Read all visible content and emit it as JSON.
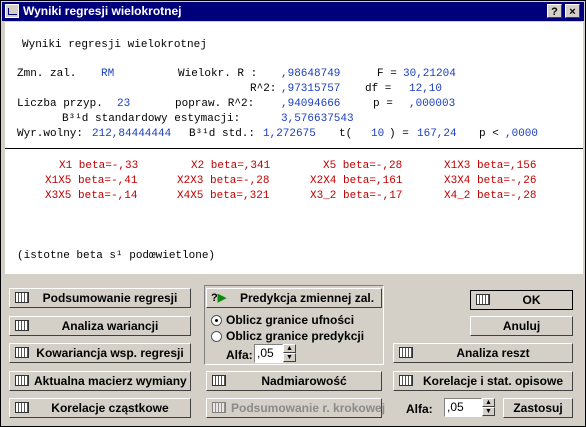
{
  "window": {
    "title": "Wyniki regresji wielokrotnej",
    "help_label": "?",
    "close_label": "×"
  },
  "output": {
    "heading": "Wyniki regresji wielokrotnej",
    "stats": {
      "zmn_label": "Zmn. zal.",
      "zmn_value": "RM",
      "r_label": "Wielokr. R :",
      "r_value": ",98648749",
      "f_label": "F =",
      "f_value": "30,21204",
      "r2_label": "R^2:",
      "r2_value": ",97315757",
      "df_label": "df =",
      "df_value": "12,10",
      "n_label": "Liczba przyp.",
      "n_value": "23",
      "adj_label": "popraw. R^2:",
      "adj_value": ",94094666",
      "p_label": "p =",
      "p_value": ",000003",
      "se_label": "B³¹d standardowy estymacji:",
      "se_value": "3,576637543",
      "int_label": "Wyr.wolny:",
      "int_value": "212,84444444",
      "int_se_label": "B³¹d std.:",
      "int_se_value": "1,272675",
      "t_label": "t(",
      "t_df": "10",
      "t_eq": ") =",
      "t_value": "167,24",
      "pp_label": "p <",
      "pp_value": ",0000"
    },
    "betas": [
      "X1 beta=-,33",
      "X2 beta=,341",
      "X5 beta=-,28",
      "X1X3 beta=,156",
      "X1X5 beta=-,41",
      "X2X3 beta=-,28",
      "X2X4 beta=,161",
      "X3X4 beta=-,26",
      "X3X5 beta=-,14",
      "X4X5 beta=,321",
      "X3_2 beta=-,17",
      "X4_2 beta=-,28"
    ],
    "footnote": "(istotne beta s¹ podœwietlone)"
  },
  "buttons": {
    "summary": "Podsumowanie regresji",
    "anova": "Analiza wariancji",
    "covariance": "Kowariancja wsp. regresji",
    "sweep": "Aktualna macierz wymiany",
    "partial": "Korelacje cząstkowe",
    "predict": "Predykcja zmiennej zal.",
    "redundancy": "Nadmiarowość",
    "stepwise": "Podsumowanie r. krokowej",
    "ok": "OK",
    "cancel": "Anuluj",
    "residuals": "Analiza reszt",
    "correlations": "Korelacje i stat. opisowe",
    "apply": "Zastosuj"
  },
  "options": {
    "confidence": "Oblicz granice ufności",
    "prediction": "Oblicz granice predykcji",
    "alpha_label": "Alfa:",
    "alpha_value": ",05",
    "alpha2_label": "Alfa:",
    "alpha2_value": ",05"
  }
}
